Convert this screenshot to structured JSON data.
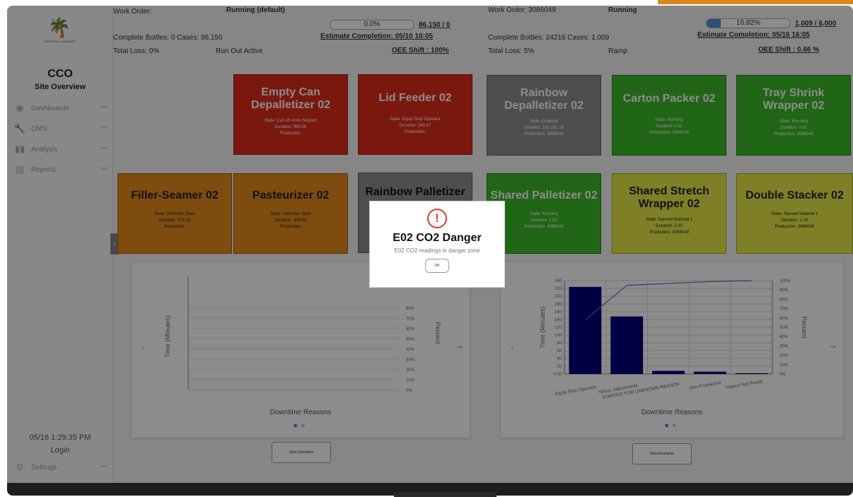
{
  "sidebar": {
    "logo_text": "CAROLINA CANNERY",
    "site_code": "CCO",
    "site_title": "Site Overview",
    "nav": [
      {
        "label": "Dashboards",
        "icon": "eye-icon"
      },
      {
        "label": "OMS",
        "icon": "wrench-icon"
      },
      {
        "label": "Analysis",
        "icon": "bar-chart-icon"
      },
      {
        "label": "Reports",
        "icon": "report-icon"
      }
    ],
    "clock": "05/16 1:29:35 PM",
    "login": "Login",
    "settings": "Settings"
  },
  "line1": {
    "work_order_label": "Work Order:",
    "status": "Running (default)",
    "progress_pct_text": "0.0%",
    "progress_fraction": 0.0,
    "count": "86,150 / 0",
    "bottles_cases": "Complete Bottles: 0 Cases: 86,150",
    "estimate": "Estimate Completion: 05/10 10:05",
    "total_loss": "Total Loss: 0%",
    "runout": "Run Out Active",
    "oee": "OEE Shift : 100%"
  },
  "line2": {
    "work_order_label": "Work Order: 3086049",
    "status": "Running",
    "progress_pct_text": "16.82%",
    "progress_fraction": 0.1682,
    "count": "1,009 / 6,000",
    "bottles_cases": "Complete Bottles: 24216 Cases: 1,009",
    "estimate": "Estimate Completion: 05/16 16:05",
    "total_loss": "Total Loss: 5%",
    "ramp": "Ramp",
    "oee": "OEE Shift : 0.66 %"
  },
  "machines_row1": [
    {
      "name": "Empty Can Depalletizer 02",
      "state": "State: Cut Lift Arms Support",
      "duration": "Duration: 995.66",
      "production": "Production:",
      "color": "red"
    },
    {
      "name": "Lid Feeder 02",
      "state": "State: Equip Stop Operator",
      "duration": "Duration: 240.07",
      "production": "Production:",
      "color": "red"
    },
    {
      "name": "Rainbow Depalletizer 02",
      "state": "State: Disabled",
      "duration": "Duration: 102,281.16",
      "production": "Production: 3086049",
      "color": "gray"
    },
    {
      "name": "Carton Packer 02",
      "state": "State: Running",
      "duration": "Duration: 0.02",
      "production": "Production: 3086049",
      "color": "green"
    },
    {
      "name": "Tray Shrink Wrapper 02",
      "state": "State: Running",
      "duration": "Duration: 0.02",
      "production": "Production: 3086049",
      "color": "green"
    }
  ],
  "machines_row2": [
    {
      "name": "Filler-Seamer 02",
      "state": "State: Unknown State",
      "duration": "Duration: 574.18",
      "production": "Production:",
      "color": "orange"
    },
    {
      "name": "Pasteurizer 02",
      "state": "State: Unknown State",
      "duration": "Duration: 306.05",
      "production": "Production:",
      "color": "orange"
    },
    {
      "name": "Rainbow Palletizer",
      "state": "",
      "duration": "",
      "production": "",
      "color": "gray"
    },
    {
      "name": "Shared Palletizer 02",
      "state": "State: Running",
      "duration": "Duration: 1.02",
      "production": "Production: 3086049",
      "color": "green"
    },
    {
      "name": "Shared Stretch Wrapper 02",
      "state": "State: Starved Material 1",
      "duration": "Duration: 2.00",
      "production": "Production: 3086049",
      "color": "yellow"
    },
    {
      "name": "Double Stacker 02",
      "state": "State: Starved Material 1",
      "duration": "Duration: 1.02",
      "production": "Production: 3086049",
      "color": "yellow"
    }
  ],
  "chart_data": [
    {
      "type": "bar",
      "title": "",
      "xlabel": "Downtime Reasons",
      "ylabel": "Time (Minutes)",
      "y2label": "Percent",
      "categories": [],
      "series": [],
      "y2_ticks": [
        "0%",
        "10%",
        "20%",
        "30%",
        "40%",
        "50%",
        "60%",
        "70%",
        "80%"
      ]
    },
    {
      "type": "bar",
      "title": "",
      "xlabel": "Downtime Reasons",
      "ylabel": "Time (Minutes)",
      "y2label": "Percent",
      "categories": [
        "Equip Stop Operator",
        "Setup, Adjustments",
        "STARVED FOR UNKNOWN REASON",
        "Non-Production",
        "Inspect Not Ready"
      ],
      "values": [
        224,
        148,
        8,
        6,
        2
      ],
      "cumulative_percent": [
        58,
        95,
        97,
        99,
        100
      ],
      "ylim": [
        0,
        240
      ],
      "y_ticks": [
        "0.00",
        "20",
        "40",
        "60",
        "80",
        "100",
        "120",
        "140",
        "160",
        "180",
        "200",
        "220",
        "240"
      ],
      "y2_ticks": [
        "0%",
        "10%",
        "20%",
        "30%",
        "40%",
        "50%",
        "60%",
        "70%",
        "80%",
        "90%",
        "100%"
      ],
      "bar_color": "#00007a",
      "line_color": "#4a6fd0"
    }
  ],
  "view_downtime": "View Downtime",
  "modal": {
    "title": "E02 CO2 Danger",
    "message": "E02 CO2 readings in danger zone",
    "ok": "OK",
    "icon_color": "#e23b2a"
  }
}
